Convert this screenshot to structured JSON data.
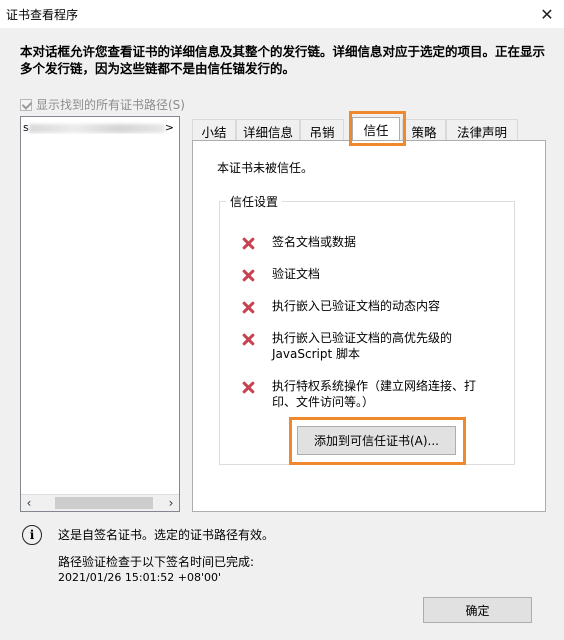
{
  "window": {
    "title": "证书查看程序",
    "close_glyph": "✕"
  },
  "description": "本对话框允许您查看证书的详细信息及其整个的发行链。详细信息对应于选定的项目。正在显示多个发行链，因为这些链都不是由信任锚发行的。",
  "show_all_paths": {
    "label": "显示找到的所有证书路径(S)",
    "checked": true,
    "enabled": false
  },
  "tree": {
    "first_char": "s",
    "last_char": ">"
  },
  "tabs": [
    {
      "label": "小结"
    },
    {
      "label": "详细信息"
    },
    {
      "label": "吊销"
    },
    {
      "label": "信任"
    },
    {
      "label": "策略"
    },
    {
      "label": "法律声明"
    }
  ],
  "active_tab": "信任",
  "trust_panel": {
    "status": "本证书未被信任。",
    "group_title": "信任设置",
    "items": [
      {
        "label": "签名文档或数据",
        "icon": "x-icon"
      },
      {
        "label": "验证文档",
        "icon": "x-icon"
      },
      {
        "label": "执行嵌入已验证文档的动态内容",
        "icon": "x-icon"
      },
      {
        "label": "执行嵌入已验证文档的高优先级的 JavaScript 脚本",
        "icon": "x-icon"
      },
      {
        "label": "执行特权系统操作（建立网络连接、打印、文件访问等。）",
        "icon": "x-icon"
      }
    ],
    "add_button": "添加到可信任证书(A)..."
  },
  "footer": {
    "valid_message": "这是自签名证书。选定的证书路径有效。",
    "check_label": "路径验证检查于以下签名时间已完成:",
    "check_time": "2021/01/26 15:01:52 +08'00'",
    "ok_button": "确定"
  },
  "colors": {
    "highlight": "#f0882e",
    "x_mark": "#c9414f"
  }
}
